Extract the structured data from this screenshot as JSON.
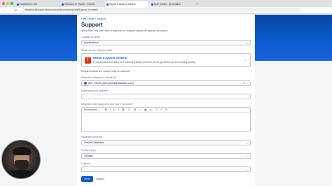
{
  "browser": {
    "tabs": [
      {
        "label": "Dashboard | Jira"
      },
      {
        "label": "Welcome to Flyweb - Flyweb"
      },
      {
        "label": "Report a system problem"
      },
      {
        "label": "Rule builder - Automation"
      }
    ],
    "new_tab": "+",
    "url": "atlassian.atlassian.net/servicedesk/customer/portal/1/group/1/create/1",
    "nav": {
      "back": "←",
      "forward": "→",
      "reload": "↻"
    }
  },
  "breadcrumb": {
    "item1": "Help Center",
    "sep": "/",
    "item2": "Support"
  },
  "page": {
    "title": "Support",
    "subtitle": "Welcome! You can raise a request for Support using the options provided."
  },
  "form": {
    "contact_label": "Contact us about",
    "contact_value": "Applications",
    "help_label": "What can we help you with?",
    "request_type": {
      "title": "Report a system problem",
      "description": "Let us know if something isn't working properly and we'll aim to get it back up and running quickly."
    },
    "required_note": "Required fields are marked with an asterisk *",
    "raise_label": "Raise this request on behalf of *",
    "raise_value": "Alex Garcia (alex.garcia@atlassian.com)",
    "summary_label": "Summarize the problem *",
    "describe_label": "Describe what happened and how it occurred *",
    "toolbar": {
      "style": "Normal text",
      "more": "···",
      "bold": "B",
      "italic": "I",
      "list1": "≡",
      "list2": "≡",
      "link": "⛓",
      "attach": "📎",
      "mention": "@",
      "emoji": "☺",
      "table": "▦",
      "code": "<>",
      "info": "ⓘ",
      "quote": "❝",
      "insert": "+▾"
    },
    "impacted_label": "Impacted Systems",
    "impacted_value": "Oracle Database",
    "incident_label": "Incident Type",
    "incident_value": "Outage",
    "urgency_label": "Urgency",
    "urgency_value": "",
    "send_label": "Send",
    "cancel_label": "Cancel"
  },
  "colors": {
    "brand": "#0052cc",
    "hero": "#0747a6",
    "problem_icon": "#de350b"
  }
}
